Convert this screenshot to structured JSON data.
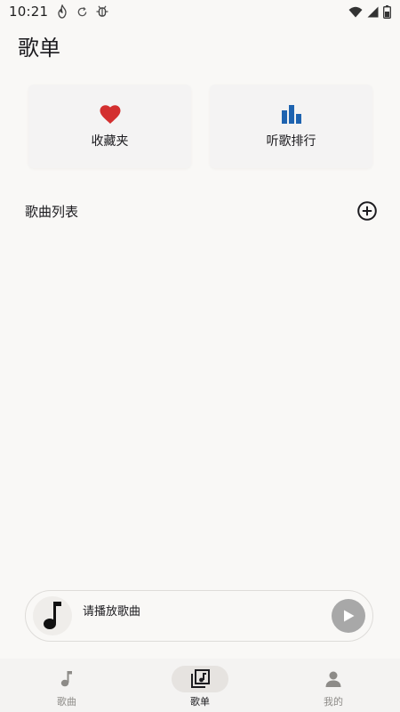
{
  "status_bar": {
    "time": "10:21",
    "left_icons": [
      "fire-icon",
      "sync-icon",
      "bug-icon"
    ],
    "right_icons": [
      "wifi-icon",
      "signal-icon",
      "battery-icon"
    ]
  },
  "page": {
    "title": "歌单"
  },
  "cards": {
    "favorites": {
      "label": "收藏夹",
      "icon": "heart-icon",
      "color": "#d32f2f"
    },
    "ranking": {
      "label": "听歌排行",
      "icon": "bar-chart-icon",
      "color": "#1e63b0"
    }
  },
  "playlist_section": {
    "title": "歌曲列表",
    "add_icon": "add-circle-icon"
  },
  "mini_player": {
    "prompt": "请播放歌曲",
    "cover_icon": "music-note-icon",
    "play_icon": "play-icon"
  },
  "bottom_nav": {
    "items": [
      {
        "label": "歌曲",
        "icon": "music-note-icon",
        "active": false
      },
      {
        "label": "歌单",
        "icon": "library-music-icon",
        "active": true
      },
      {
        "label": "我的",
        "icon": "person-icon",
        "active": false
      }
    ]
  },
  "colors": {
    "background": "#f9f8f6",
    "heart": "#d32f2f",
    "chart": "#1e63b0",
    "play_button": "#a8a8a8"
  }
}
